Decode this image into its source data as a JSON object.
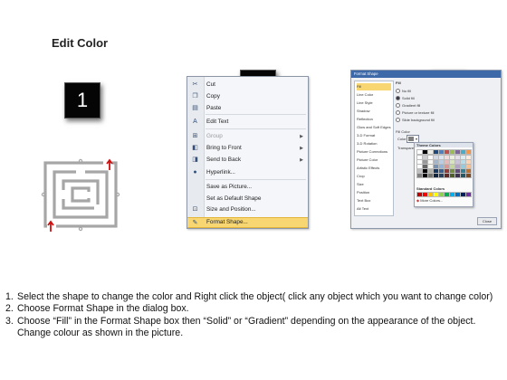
{
  "title": "Edit Color",
  "steps": [
    "1",
    "2",
    "3"
  ],
  "context_menu": {
    "items": [
      {
        "label": "Cut",
        "icon": "scissors-icon",
        "glyph": "✂",
        "disabled": false,
        "submenu": false,
        "highlighted": false
      },
      {
        "label": "Copy",
        "icon": "copy-icon",
        "glyph": "❐",
        "disabled": false,
        "submenu": false,
        "highlighted": false
      },
      {
        "label": "Paste",
        "icon": "paste-icon",
        "glyph": "▤",
        "disabled": false,
        "submenu": false,
        "highlighted": false
      },
      {
        "label": "Edit Text",
        "icon": "edit-text-icon",
        "glyph": "A",
        "disabled": false,
        "submenu": false,
        "highlighted": false
      },
      {
        "label": "Group",
        "icon": "group-icon",
        "glyph": "⊞",
        "disabled": true,
        "submenu": true,
        "highlighted": false
      },
      {
        "label": "Bring to Front",
        "icon": "bring-front-icon",
        "glyph": "◧",
        "disabled": false,
        "submenu": true,
        "highlighted": false
      },
      {
        "label": "Send to Back",
        "icon": "send-back-icon",
        "glyph": "◨",
        "disabled": false,
        "submenu": true,
        "highlighted": false
      },
      {
        "label": "Hyperlink...",
        "icon": "hyperlink-icon",
        "glyph": "●",
        "disabled": false,
        "submenu": false,
        "highlighted": false
      },
      {
        "label": "Save as Picture...",
        "icon": "",
        "glyph": "",
        "disabled": false,
        "submenu": false,
        "highlighted": false
      },
      {
        "label": "Set as Default Shape",
        "icon": "",
        "glyph": "",
        "disabled": false,
        "submenu": false,
        "highlighted": false
      },
      {
        "label": "Size and Position...",
        "icon": "size-position-icon",
        "glyph": "⊡",
        "disabled": false,
        "submenu": false,
        "highlighted": false
      },
      {
        "label": "Format Shape...",
        "icon": "format-shape-icon",
        "glyph": "✎",
        "disabled": false,
        "submenu": false,
        "highlighted": true
      }
    ]
  },
  "format_dialog": {
    "title": "Format Shape",
    "nav": [
      "Fill",
      "Line Color",
      "Line Style",
      "Shadow",
      "Reflection",
      "Glow and Soft Edges",
      "3-D Format",
      "3-D Rotation",
      "Picture Corrections",
      "Picture Color",
      "Artistic Effects",
      "Crop",
      "Size",
      "Position",
      "Text Box",
      "Alt Text"
    ],
    "pane_heading": "Fill",
    "options": [
      {
        "label": "No fill",
        "selected": false
      },
      {
        "label": "Solid fill",
        "selected": true
      },
      {
        "label": "Gradient fill",
        "selected": false
      },
      {
        "label": "Picture or texture fill",
        "selected": false
      },
      {
        "label": "Slide background fill",
        "selected": false
      }
    ],
    "fill_color_label": "Fill Color",
    "color_label": "Color:",
    "transparency_label": "Transparency:",
    "palette": {
      "theme_label": "Theme Colors",
      "standard_label": "Standard Colors",
      "more_label": "More Colors...",
      "theme_top": [
        "#ffffff",
        "#000000",
        "#eeece1",
        "#1f497d",
        "#4f81bd",
        "#c0504d",
        "#9bbb59",
        "#8064a2",
        "#4bacc6",
        "#f79646"
      ],
      "standard": [
        "#c00000",
        "#ff0000",
        "#ffc000",
        "#ffff00",
        "#92d050",
        "#00b050",
        "#00b0f0",
        "#0070c0",
        "#002060",
        "#7030a0"
      ]
    },
    "close_label": "Close"
  },
  "instructions": [
    {
      "num": "1.",
      "text": "Select the shape to change the color and Right click the object( click any object which you want to change color)"
    },
    {
      "num": "2.",
      "text": "Choose Format Shape in the dialog box."
    },
    {
      "num": "3.",
      "text": "Choose “Fill” in the Format Shape box then “Solid” or “Gradient” depending on the appearance of the object. Change colour as shown in the picture."
    }
  ],
  "colors": {
    "highlight": "#f8d772",
    "dialog_title": "#3d69a8",
    "arrow": "#cc1111"
  }
}
